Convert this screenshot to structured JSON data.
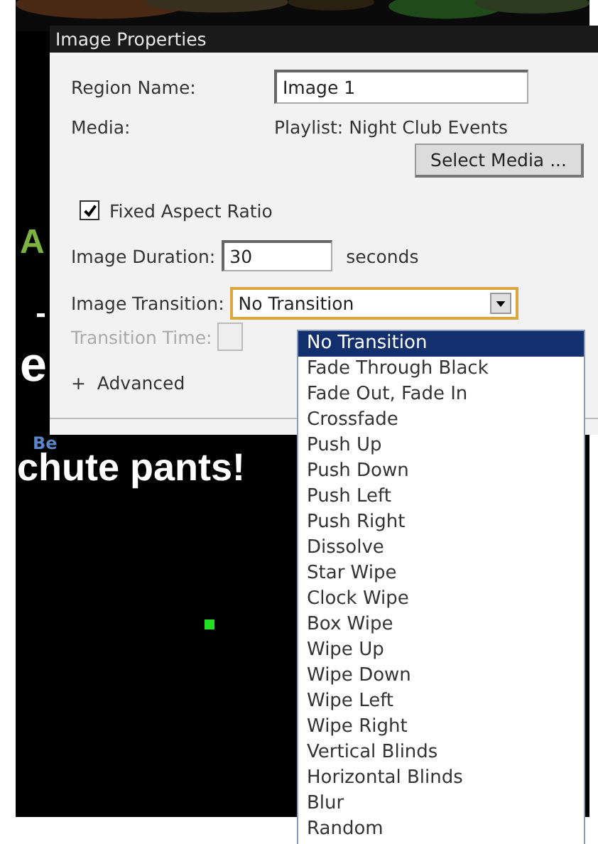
{
  "background": {
    "fragments": [
      {
        "kind": "big-green",
        "text": "A"
      },
      {
        "kind": "dash",
        "text": "-"
      },
      {
        "kind": "big-white",
        "text": "e"
      },
      {
        "kind": "small-blue",
        "text": "Be"
      },
      {
        "kind": "headline",
        "text": "chute pants!"
      }
    ]
  },
  "dialog": {
    "title": "Image Properties",
    "region_name": {
      "label": "Region Name:",
      "value": "Image 1"
    },
    "media": {
      "label": "Media:",
      "value": "Playlist: Night Club Events"
    },
    "select_media_button": "Select Media ...",
    "fixed_aspect_ratio": {
      "label": "Fixed Aspect Ratio",
      "checked": true
    },
    "image_duration": {
      "label": "Image Duration:",
      "value": "30",
      "unit": "seconds"
    },
    "image_transition": {
      "label": "Image Transition:",
      "value": "No Transition",
      "expanded": true
    },
    "transition_time": {
      "label": "Transition Time:",
      "disabled": true
    },
    "advanced": {
      "icon": "+",
      "label": "Advanced",
      "expanded": false
    }
  },
  "transition_options": [
    {
      "label": "No Transition",
      "selected": true
    },
    {
      "label": "Fade Through Black",
      "selected": false
    },
    {
      "label": "Fade Out, Fade In",
      "selected": false
    },
    {
      "label": "Crossfade",
      "selected": false
    },
    {
      "label": "Push Up",
      "selected": false
    },
    {
      "label": "Push Down",
      "selected": false
    },
    {
      "label": "Push Left",
      "selected": false
    },
    {
      "label": "Push Right",
      "selected": false
    },
    {
      "label": "Dissolve",
      "selected": false
    },
    {
      "label": "Star Wipe",
      "selected": false
    },
    {
      "label": "Clock Wipe",
      "selected": false
    },
    {
      "label": "Box Wipe",
      "selected": false
    },
    {
      "label": "Wipe Up",
      "selected": false
    },
    {
      "label": "Wipe Down",
      "selected": false
    },
    {
      "label": "Wipe Left",
      "selected": false
    },
    {
      "label": "Wipe Right",
      "selected": false
    },
    {
      "label": "Vertical Blinds",
      "selected": false
    },
    {
      "label": "Horizontal Blinds",
      "selected": false
    },
    {
      "label": "Blur",
      "selected": false
    },
    {
      "label": "Random",
      "selected": false
    }
  ]
}
